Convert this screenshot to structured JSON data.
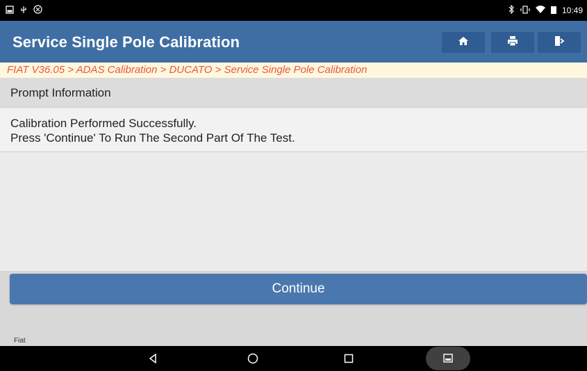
{
  "statusbar": {
    "time": "10:49",
    "left_icons": [
      "image-icon",
      "usb-icon",
      "settings-circle-icon"
    ],
    "right_icons": [
      "bluetooth-icon",
      "vibrate-icon",
      "wifi-icon",
      "battery-icon"
    ]
  },
  "header": {
    "title": "Service Single Pole Calibration",
    "buttons": [
      "home-icon",
      "print-icon",
      "exit-icon"
    ]
  },
  "breadcrumb": {
    "text": "FIAT V36.05 > ADAS Calibration > DUCATO > Service Single Pole Calibration"
  },
  "prompt": {
    "header": "Prompt Information",
    "line1": "Calibration Performed Successfully.",
    "line2": "Press 'Continue' To Run The Second Part Of The Test."
  },
  "actions": {
    "continue_label": "Continue"
  },
  "footer": {
    "make": "Fiat"
  },
  "navbar": {
    "items": [
      "back-icon",
      "home-circle-icon",
      "recents-icon",
      "screenshot-icon"
    ]
  },
  "colors": {
    "header_bg": "#3f6ea4",
    "button_bg": "#4a78ae",
    "breadcrumb_text": "#e8593b"
  }
}
